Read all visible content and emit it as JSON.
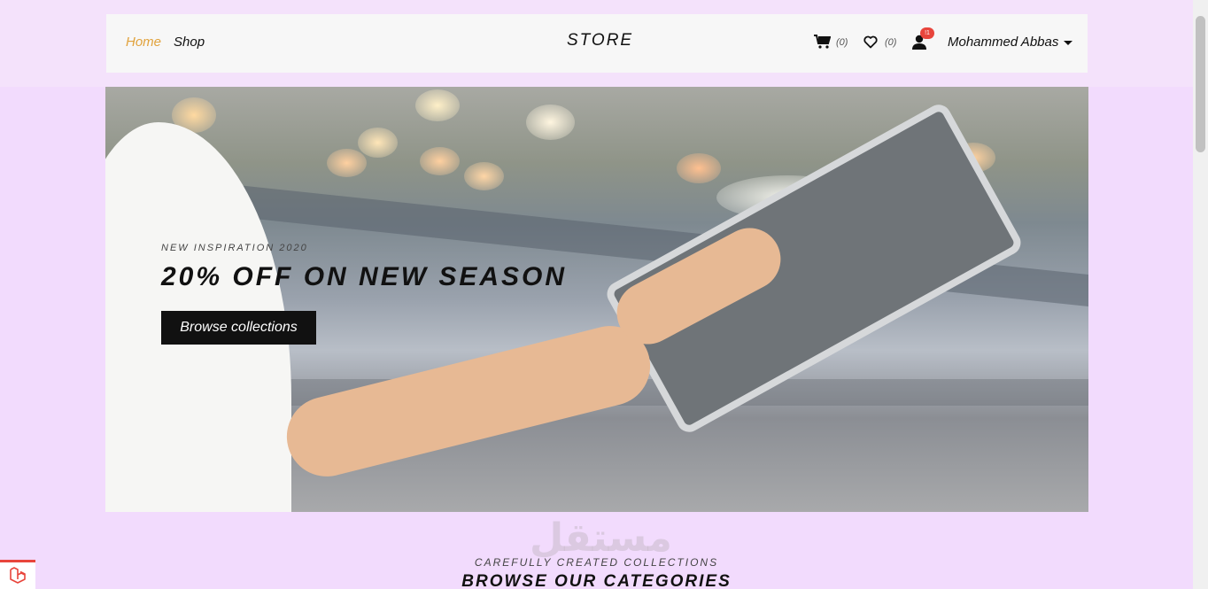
{
  "nav": {
    "home_label": "Home",
    "shop_label": "Shop",
    "brand": "STORE",
    "cart_count": "(0)",
    "wishlist_count": "(0)",
    "notifications_badge": "!1",
    "user_name": "Mohammed Abbas"
  },
  "hero": {
    "subtitle": "NEW INSPIRATION 2020",
    "title": "20% OFF ON NEW SEASON",
    "button_label": "Browse collections"
  },
  "section": {
    "subtitle": "CAREFULLY CREATED COLLECTIONS",
    "title": "BROWSE OUR CATEGORIES"
  },
  "watermark": "مستقل",
  "colors": {
    "accent": "#e1a23c",
    "background": "#f2dbfd",
    "badge": "#e8453c"
  }
}
